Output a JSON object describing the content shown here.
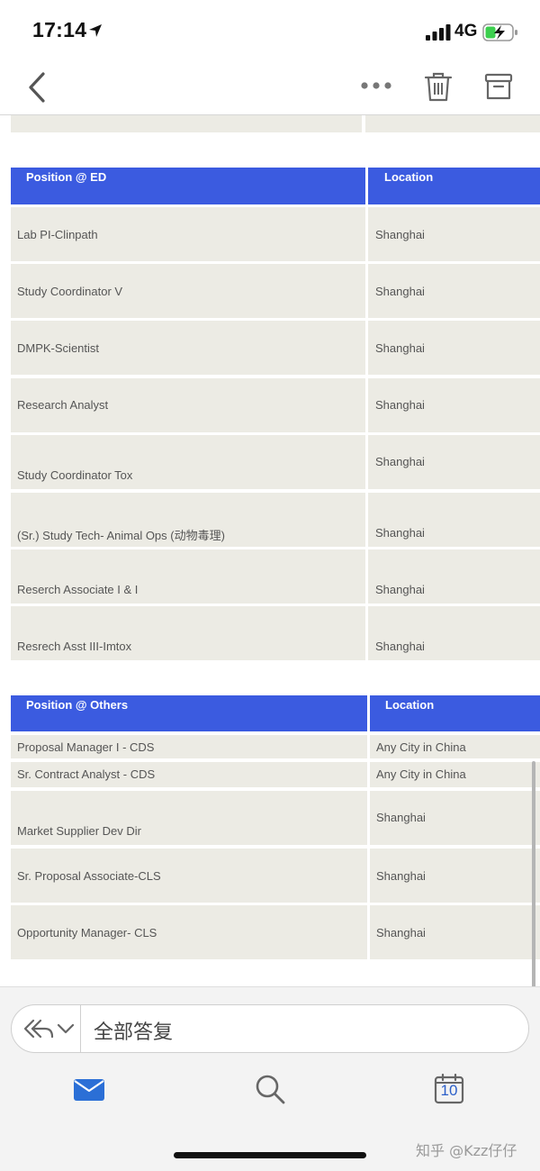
{
  "status_bar": {
    "time": "17:14",
    "network": "4G",
    "icons": [
      "location-arrow-icon",
      "signal-bars-icon",
      "battery-charging-icon"
    ]
  },
  "toolbar": {
    "icons": [
      "back-chevron-icon",
      "more-dots-icon",
      "trash-icon",
      "archive-icon"
    ]
  },
  "tables": {
    "ed": {
      "headers": [
        "Position @ ED",
        "Location"
      ],
      "rows": [
        [
          "Lab PI-Clinpath",
          "Shanghai"
        ],
        [
          "Study Coordinator V",
          "Shanghai"
        ],
        [
          "DMPK-Scientist",
          "Shanghai"
        ],
        [
          "Research Analyst",
          "Shanghai"
        ],
        [
          "Study Coordinator Tox",
          "Shanghai"
        ],
        [
          "(Sr.) Study Tech- Animal Ops (动物毒理)",
          "Shanghai"
        ],
        [
          "Reserch Associate I & I",
          "Shanghai"
        ],
        [
          "Resrech Asst III-Imtox",
          "Shanghai"
        ]
      ]
    },
    "others": {
      "headers": [
        "Position @ Others",
        "Location"
      ],
      "rows": [
        [
          "Proposal Manager I - CDS",
          "Any City in China"
        ],
        [
          "Sr. Contract Analyst - CDS",
          "Any City in China"
        ],
        [
          "Market Supplier Dev Dir",
          "Shanghai"
        ],
        [
          "Sr. Proposal Associate-CLS",
          "Shanghai"
        ],
        [
          "Opportunity Manager- CLS",
          "Shanghai"
        ]
      ]
    }
  },
  "reply_bar": {
    "label": "全部答复",
    "icons": [
      "reply-all-icon",
      "chevron-down-icon"
    ]
  },
  "tab_bar": {
    "icons": [
      "mail-icon",
      "search-icon",
      "calendar-icon"
    ],
    "calendar_day": "10"
  },
  "watermark": "知乎 @Kzz仔仔",
  "colors": {
    "header_blue": "#3b5be0",
    "cell_bg": "#ecebe4",
    "accent_blue": "#2b5fc9"
  }
}
